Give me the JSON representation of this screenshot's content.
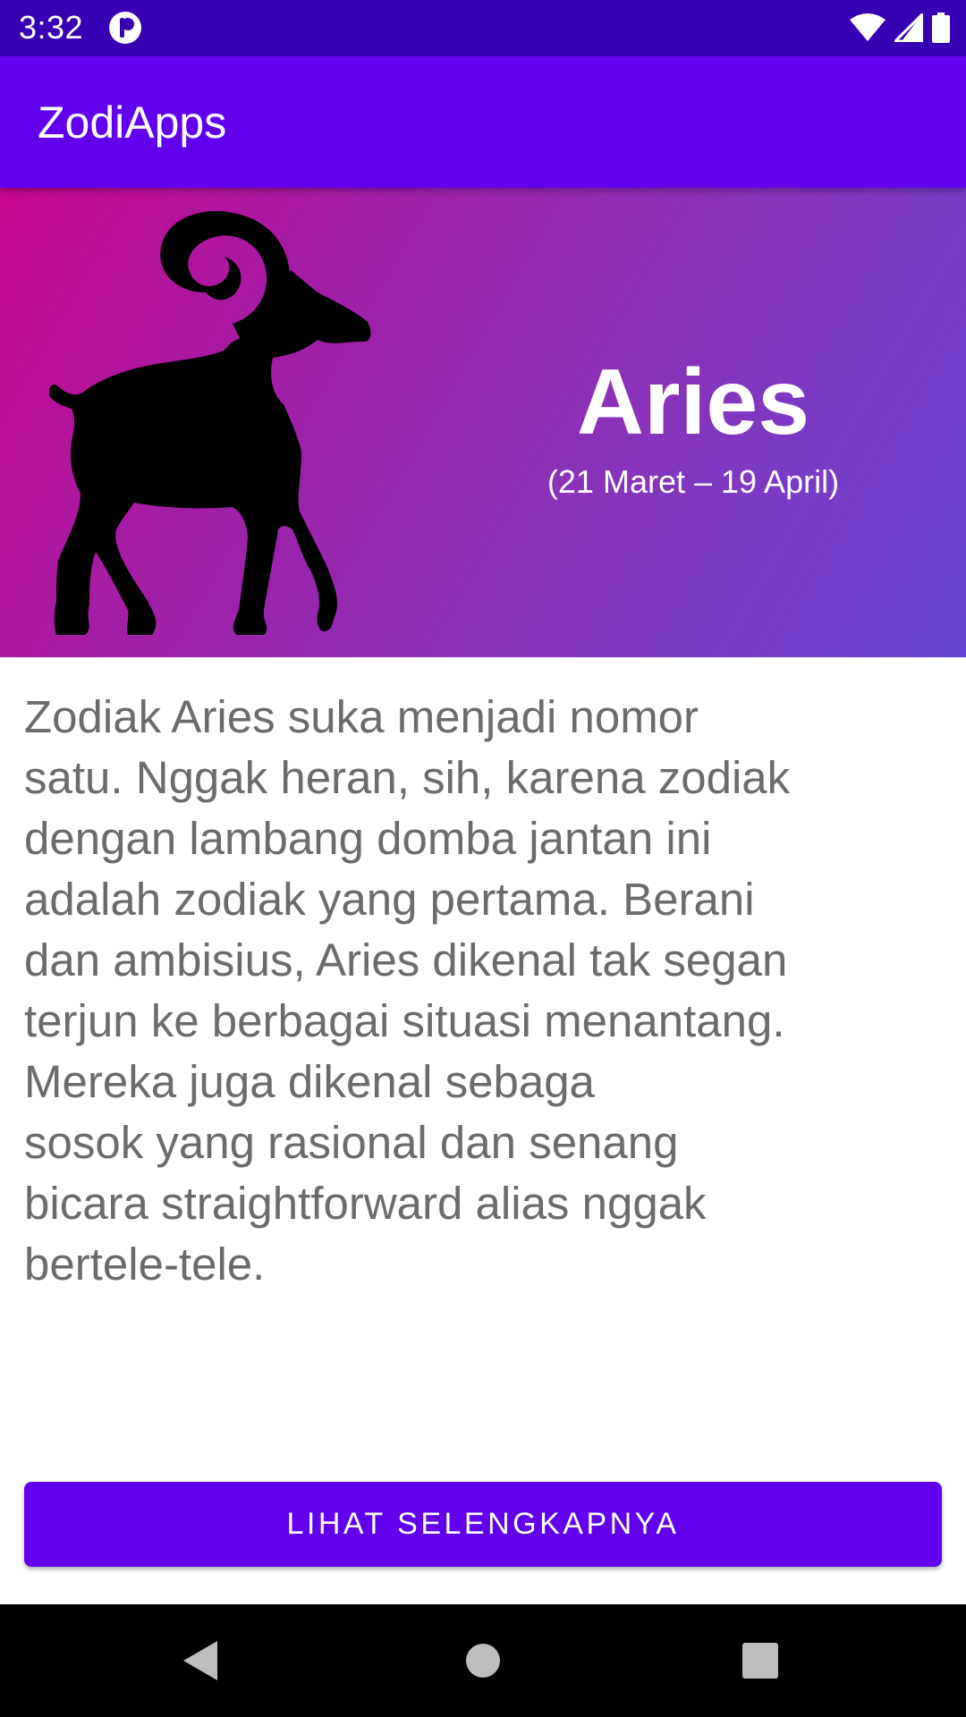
{
  "status_bar": {
    "time": "3:32",
    "icons": [
      "app-notification-icon",
      "wifi-icon",
      "cell-signal-icon",
      "battery-icon"
    ]
  },
  "app_bar": {
    "title": "ZodiApps"
  },
  "hero": {
    "image": "aries-ram-icon",
    "title": "Aries",
    "dates": "(21 Maret – 19 April)"
  },
  "description": "   Zodiak Aries suka menjadi nomor\nsatu. Nggak heran, sih, karena zodiak\ndengan lambang domba jantan ini\nadalah zodiak yang pertama. Berani\ndan ambisius, Aries dikenal tak segan\nterjun ke berbagai situasi menantang.\nMereka juga dikenal sebaga\nsosok yang rasional dan senang\nbicara straightforward alias nggak\nbertele-tele.",
  "button": {
    "label": "LIHAT SELENGKAPNYA"
  },
  "nav_bar": {
    "buttons": [
      "back-icon",
      "home-icon",
      "recents-icon"
    ]
  },
  "colors": {
    "status_bar": "#3700B3",
    "primary": "#6200EE",
    "text_secondary": "#6B6B6B",
    "hero_gradient_start": "#C8068F",
    "hero_gradient_end": "#6545D3"
  }
}
